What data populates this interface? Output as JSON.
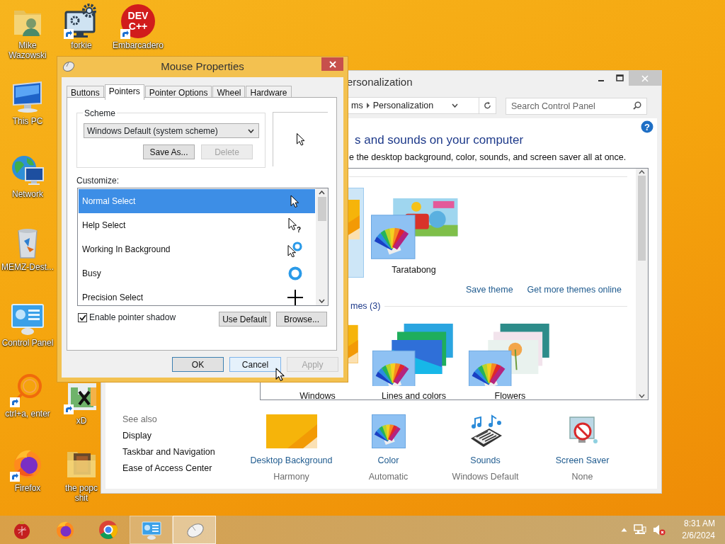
{
  "desktop_icons": [
    {
      "label": "Mike Wazowski",
      "kind": "user-folder",
      "shortcut": false
    },
    {
      "label": "forkie",
      "kind": "settings-monitor",
      "shortcut": true
    },
    {
      "label": "Embarcadero",
      "kind": "dev-badge",
      "badge": [
        "DEV",
        "C++"
      ],
      "shortcut": true
    },
    {
      "label": "This PC",
      "kind": "computer",
      "shortcut": false
    },
    {
      "label": "Network",
      "kind": "network",
      "shortcut": false
    },
    {
      "label": "MEMZ-Dest...",
      "kind": "recycle-bin",
      "shortcut": false
    },
    {
      "label": "Control Panel",
      "kind": "control-panel",
      "shortcut": false
    },
    {
      "label": "ctrl+a, enter",
      "kind": "ring",
      "shortcut": true
    },
    {
      "label": "xD",
      "kind": "image",
      "shortcut": true
    },
    {
      "label": "Firefox",
      "kind": "firefox",
      "shortcut": true
    },
    {
      "label": "the popc shit",
      "kind": "folder",
      "shortcut": false
    }
  ],
  "personalization_window": {
    "title": "ersonalization",
    "breadcrumb": [
      "ms",
      "Personalization"
    ],
    "search": {
      "placeholder": "Search Control Panel"
    },
    "help_glyph": "?",
    "heading": "s and sounds on your computer",
    "description": "e the desktop background, color, sounds, and screen saver all at once.",
    "my_themes": [
      {
        "kind": "harmony",
        "selected": true
      },
      {
        "label": "Taratabong",
        "kind": "taratabong",
        "selected": false
      }
    ],
    "links": [
      "Save theme",
      "Get more themes online"
    ],
    "default_group_title": "mes (3)",
    "default_themes": [
      {
        "label": "Windows",
        "kind": "harmony",
        "selected": false
      },
      {
        "label": "Lines and colors",
        "kind": "lines",
        "selected": false
      },
      {
        "label": "Flowers",
        "kind": "flowers",
        "selected": false
      }
    ],
    "see_also": {
      "title": "See also",
      "links": [
        "Display",
        "Taskbar and Navigation",
        "Ease of Access Center"
      ]
    },
    "settings": [
      {
        "label": "Desktop Background",
        "value": "Harmony",
        "kind": "background"
      },
      {
        "label": "Color",
        "value": "Automatic",
        "kind": "color"
      },
      {
        "label": "Sounds",
        "value": "Windows Default",
        "kind": "sounds"
      },
      {
        "label": "Screen Saver",
        "value": "None",
        "kind": "screen-saver"
      }
    ]
  },
  "dialog": {
    "title": "Mouse Properties",
    "tabs": [
      {
        "label": "Buttons",
        "selected": false
      },
      {
        "label": "Pointers",
        "selected": true
      },
      {
        "label": "Pointer Options",
        "selected": false
      },
      {
        "label": "Wheel",
        "selected": false
      },
      {
        "label": "Hardware",
        "selected": false
      }
    ],
    "scheme": {
      "label": "Scheme",
      "value": "Windows Default (system scheme)"
    },
    "scheme_buttons": [
      {
        "label": "Save As...",
        "disabled": false
      },
      {
        "label": "Delete",
        "disabled": true
      }
    ],
    "customize_label": "Customize:",
    "pointers": [
      {
        "name": "Normal Select",
        "kind": "arrow",
        "selected": true
      },
      {
        "name": "Help Select",
        "kind": "help",
        "glyph": "?",
        "selected": false
      },
      {
        "name": "Working In Background",
        "kind": "working",
        "selected": false
      },
      {
        "name": "Busy",
        "kind": "busy",
        "selected": false
      },
      {
        "name": "Precision Select",
        "kind": "cross",
        "selected": false
      }
    ],
    "pointer_shadow": {
      "label": "Enable pointer shadow",
      "checked": true
    },
    "list_buttons": [
      {
        "label": "Use Default",
        "disabled": false
      },
      {
        "label": "Browse...",
        "disabled": false
      }
    ],
    "buttons": [
      {
        "label": "OK",
        "disabled": false,
        "default": true,
        "hovered": false
      },
      {
        "label": "Cancel",
        "disabled": false,
        "default": false,
        "hovered": true
      },
      {
        "label": "Apply",
        "disabled": true,
        "default": false,
        "hovered": false
      }
    ]
  },
  "taskbar": {
    "apps": [
      {
        "kind": "ornament",
        "running": false,
        "focused": false
      },
      {
        "kind": "firefox",
        "running": false,
        "focused": false
      },
      {
        "kind": "chrome",
        "running": false,
        "focused": false
      },
      {
        "kind": "control-panel",
        "running": true,
        "focused": false
      },
      {
        "kind": "mouse",
        "running": true,
        "focused": true
      }
    ],
    "clock": {
      "time": "8:31 AM",
      "date": "2/6/2024"
    }
  }
}
